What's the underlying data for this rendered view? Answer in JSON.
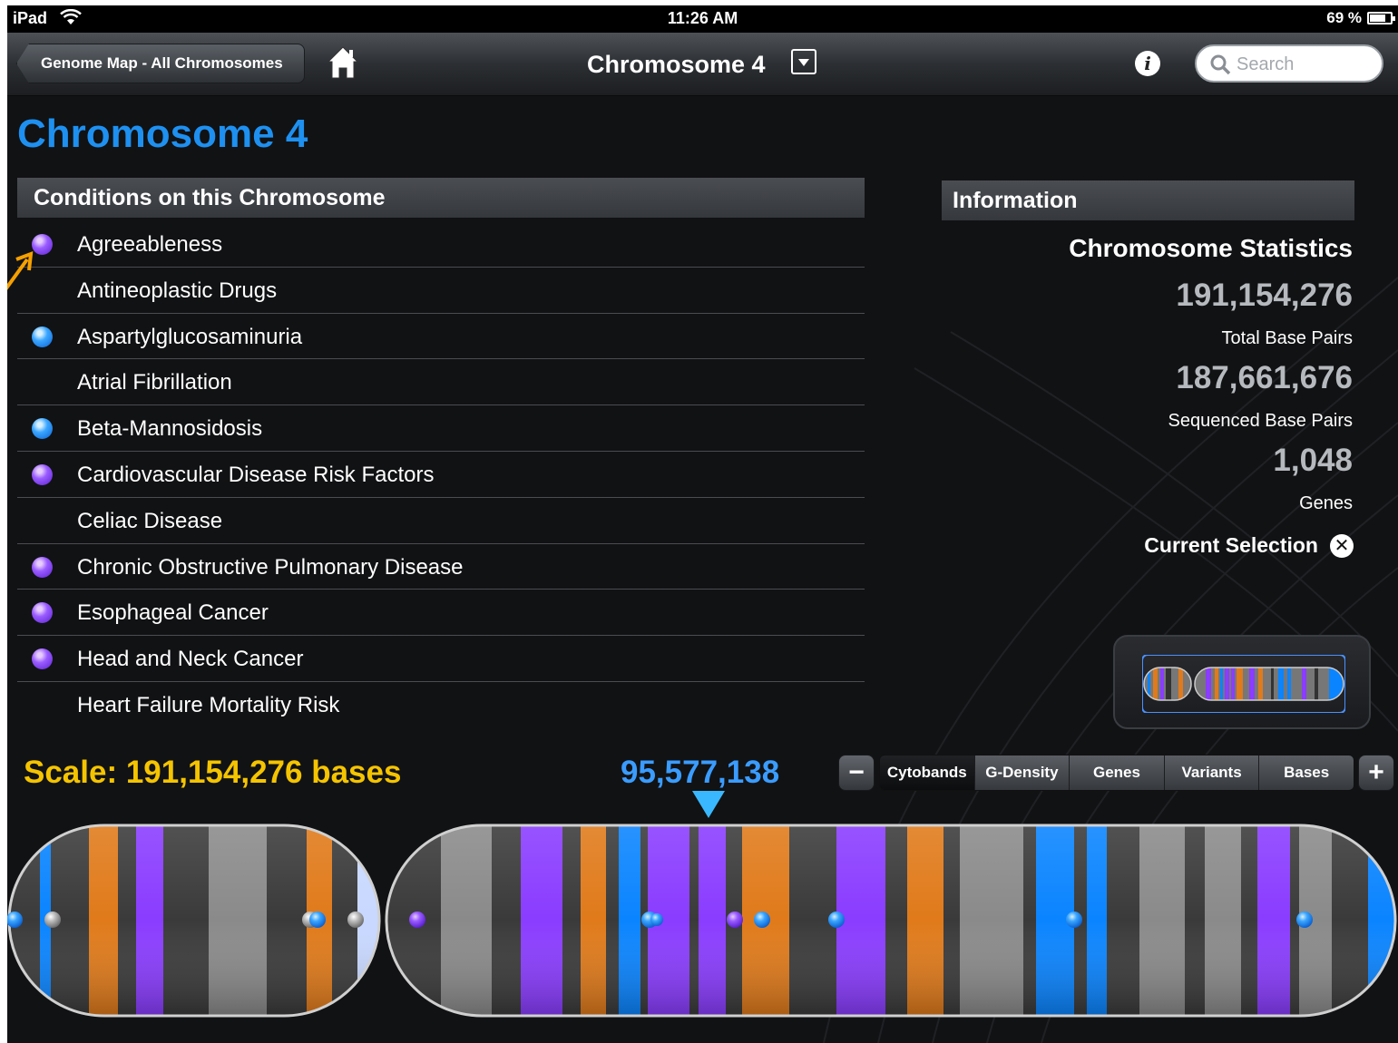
{
  "status_bar": {
    "device": "iPad",
    "time": "11:26 AM",
    "battery": "69 %"
  },
  "nav": {
    "back_label": "Genome Map - All Chromosomes",
    "title": "Chromosome 4",
    "search_placeholder": "Search"
  },
  "page_title": "Chromosome 4",
  "conditions": {
    "header": "Conditions on this Chromosome",
    "items": [
      {
        "label": "Agreeableness",
        "marker": "purple"
      },
      {
        "label": "Antineoplastic Drugs",
        "marker": "none"
      },
      {
        "label": "Aspartylglucosaminuria",
        "marker": "blue"
      },
      {
        "label": "Atrial Fibrillation",
        "marker": "none"
      },
      {
        "label": "Beta-Mannosidosis",
        "marker": "blue"
      },
      {
        "label": "Cardiovascular Disease Risk Factors",
        "marker": "purple"
      },
      {
        "label": "Celiac Disease",
        "marker": "none"
      },
      {
        "label": "Chronic Obstructive Pulmonary Disease",
        "marker": "purple"
      },
      {
        "label": "Esophageal Cancer",
        "marker": "purple"
      },
      {
        "label": "Head and Neck Cancer",
        "marker": "purple"
      },
      {
        "label": "Heart Failure Mortality Risk",
        "marker": "none"
      }
    ]
  },
  "information": {
    "header": "Information",
    "stats_title": "Chromosome Statistics",
    "stats": [
      {
        "value": "191,154,276",
        "label": "Total Base Pairs"
      },
      {
        "value": "187,661,676",
        "label": "Sequenced Base Pairs"
      },
      {
        "value": "1,048",
        "label": "Genes"
      }
    ],
    "current_selection": "Current Selection"
  },
  "scale": {
    "label": "Scale: 191,154,276 bases",
    "position": "95,577,138"
  },
  "view_modes": {
    "selected": "Cytobands",
    "options": [
      "Cytobands",
      "G-Density",
      "Genes",
      "Variants",
      "Bases"
    ]
  },
  "colors": {
    "title_blue": "#1e90f0",
    "scale_yellow": "#f5c400",
    "band_purple": "#8a3cff",
    "band_blue": "#0a84ff",
    "band_orange": "#e07a1a"
  },
  "icons": {
    "home": "home-icon",
    "dropdown": "dropdown-icon",
    "info": "info-icon",
    "search": "search-icon",
    "clear": "clear-selection-icon",
    "zoom_out": "minus",
    "zoom_in": "plus"
  }
}
